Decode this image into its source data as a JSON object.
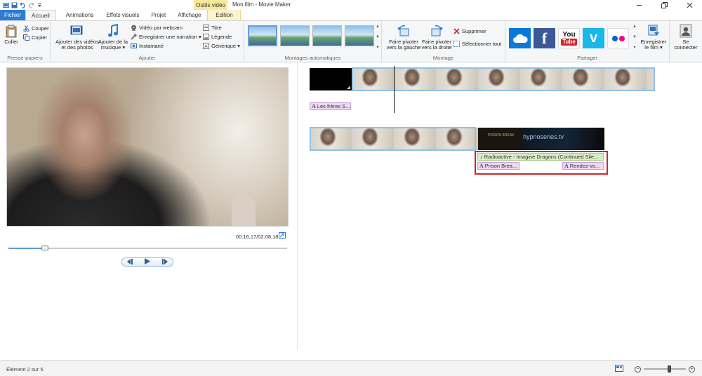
{
  "window": {
    "title": "Mon film - Movie Maker",
    "context_tab_header": "Outils vidéo"
  },
  "tabs": [
    {
      "label": "Fichier"
    },
    {
      "label": "Accueil"
    },
    {
      "label": "Animations"
    },
    {
      "label": "Effets visuels"
    },
    {
      "label": "Projet"
    },
    {
      "label": "Affichage"
    },
    {
      "label": "Edition"
    }
  ],
  "ribbon": {
    "clipboard": {
      "label": "Presse-papiers",
      "paste": "Coller",
      "cut": "Couper",
      "copy": "Copier"
    },
    "add": {
      "label": "Ajouter",
      "add_videos_line1": "Ajouter des vidéos",
      "add_videos_line2": "et des photos",
      "add_music_line1": "Ajouter de la",
      "add_music_line2": "musique ▾",
      "webcam": "Vidéo par webcam",
      "narration": "Enregistrer une narration ▾",
      "snapshot": "Instantané",
      "title": "Titre",
      "caption": "Légende",
      "credits": "Générique ▾"
    },
    "automovie": {
      "label": "Montages automatiques"
    },
    "editing": {
      "label": "Montage",
      "rotate_left_line1": "Faire pivoter",
      "rotate_left_line2": "vers la gauche",
      "rotate_right_line1": "Faire pivoter",
      "rotate_right_line2": "vers la droite",
      "remove": "Supprimer",
      "select_all": "Sélectionner tout"
    },
    "share": {
      "label": "Partager",
      "save_movie_line1": "Enregistrer",
      "save_movie_line2": "le film ▾"
    },
    "signin": {
      "line1": "Se",
      "line2": "connecter"
    }
  },
  "preview": {
    "timecode": "00:16,17/02:08,18",
    "progress": 0.13
  },
  "storyboard": {
    "caption1": "Les frères S...",
    "music": "Radioactive - Imagine Dragons (Continued Sile...",
    "caption2": "Prison Brea...",
    "caption3": "Rendez-vo...",
    "hypno_small": "PRISON BREAK",
    "hypno_logo": "hypnoseries.tv"
  },
  "status": {
    "text": "Élément 2 sur 5",
    "zoom_minus": "−",
    "zoom_plus": "+",
    "zoom_level": 0.6
  },
  "colors": {
    "accent": "#2b7cd3",
    "context": "#f6e99a",
    "selection": "#8fc2e6",
    "highlight": "#d2232a"
  }
}
